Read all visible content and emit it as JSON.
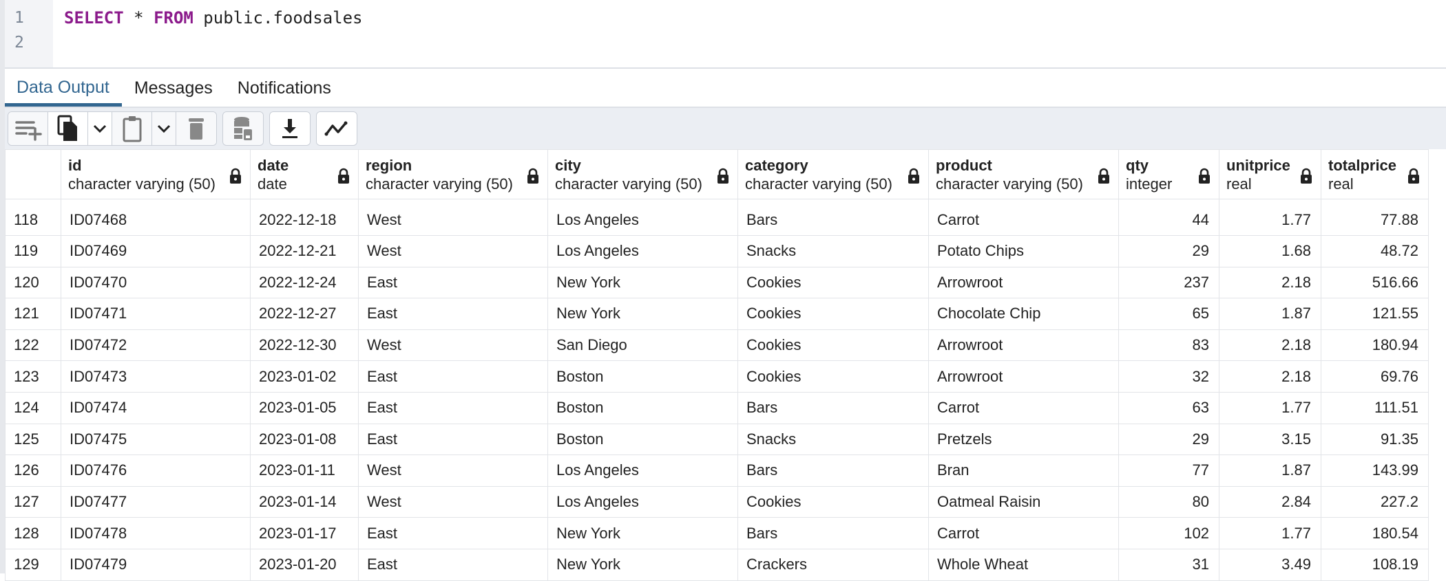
{
  "editor": {
    "line_numbers": [
      "1",
      "2"
    ],
    "query": {
      "kw1": "SELECT",
      "star": " * ",
      "kw2": "FROM",
      "rest": " public.foodsales"
    }
  },
  "tabs": [
    {
      "label": "Data Output",
      "active": true
    },
    {
      "label": "Messages",
      "active": false
    },
    {
      "label": "Notifications",
      "active": false
    }
  ],
  "toolbar": [
    "add-row-icon",
    "copy-icon",
    "copy-dropdown-icon",
    "paste-icon",
    "paste-dropdown-icon",
    "delete-icon",
    "save-data-icon",
    "download-icon",
    "graph-icon"
  ],
  "columns": [
    {
      "name": "id",
      "type": "character varying (50)"
    },
    {
      "name": "date",
      "type": "date"
    },
    {
      "name": "region",
      "type": "character varying (50)"
    },
    {
      "name": "city",
      "type": "character varying (50)"
    },
    {
      "name": "category",
      "type": "character varying (50)"
    },
    {
      "name": "product",
      "type": "character varying (50)"
    },
    {
      "name": "qty",
      "type": "integer"
    },
    {
      "name": "unitprice",
      "type": "real"
    },
    {
      "name": "totalprice",
      "type": "real"
    }
  ],
  "rows": [
    [
      "118",
      "ID07468",
      "2022-12-18",
      "West",
      "Los Angeles",
      "Bars",
      "Carrot",
      "44",
      "1.77",
      "77.88"
    ],
    [
      "119",
      "ID07469",
      "2022-12-21",
      "West",
      "Los Angeles",
      "Snacks",
      "Potato Chips",
      "29",
      "1.68",
      "48.72"
    ],
    [
      "120",
      "ID07470",
      "2022-12-24",
      "East",
      "New York",
      "Cookies",
      "Arrowroot",
      "237",
      "2.18",
      "516.66"
    ],
    [
      "121",
      "ID07471",
      "2022-12-27",
      "East",
      "New York",
      "Cookies",
      "Chocolate Chip",
      "65",
      "1.87",
      "121.55"
    ],
    [
      "122",
      "ID07472",
      "2022-12-30",
      "West",
      "San Diego",
      "Cookies",
      "Arrowroot",
      "83",
      "2.18",
      "180.94"
    ],
    [
      "123",
      "ID07473",
      "2023-01-02",
      "East",
      "Boston",
      "Cookies",
      "Arrowroot",
      "32",
      "2.18",
      "69.76"
    ],
    [
      "124",
      "ID07474",
      "2023-01-05",
      "East",
      "Boston",
      "Bars",
      "Carrot",
      "63",
      "1.77",
      "111.51"
    ],
    [
      "125",
      "ID07475",
      "2023-01-08",
      "East",
      "Boston",
      "Snacks",
      "Pretzels",
      "29",
      "3.15",
      "91.35"
    ],
    [
      "126",
      "ID07476",
      "2023-01-11",
      "West",
      "Los Angeles",
      "Bars",
      "Bran",
      "77",
      "1.87",
      "143.99"
    ],
    [
      "127",
      "ID07477",
      "2023-01-14",
      "West",
      "Los Angeles",
      "Cookies",
      "Oatmeal Raisin",
      "80",
      "2.84",
      "227.2"
    ],
    [
      "128",
      "ID07478",
      "2023-01-17",
      "East",
      "New York",
      "Bars",
      "Carrot",
      "102",
      "1.77",
      "180.54"
    ],
    [
      "129",
      "ID07479",
      "2023-01-20",
      "East",
      "New York",
      "Crackers",
      "Whole Wheat",
      "31",
      "3.49",
      "108.19"
    ]
  ]
}
